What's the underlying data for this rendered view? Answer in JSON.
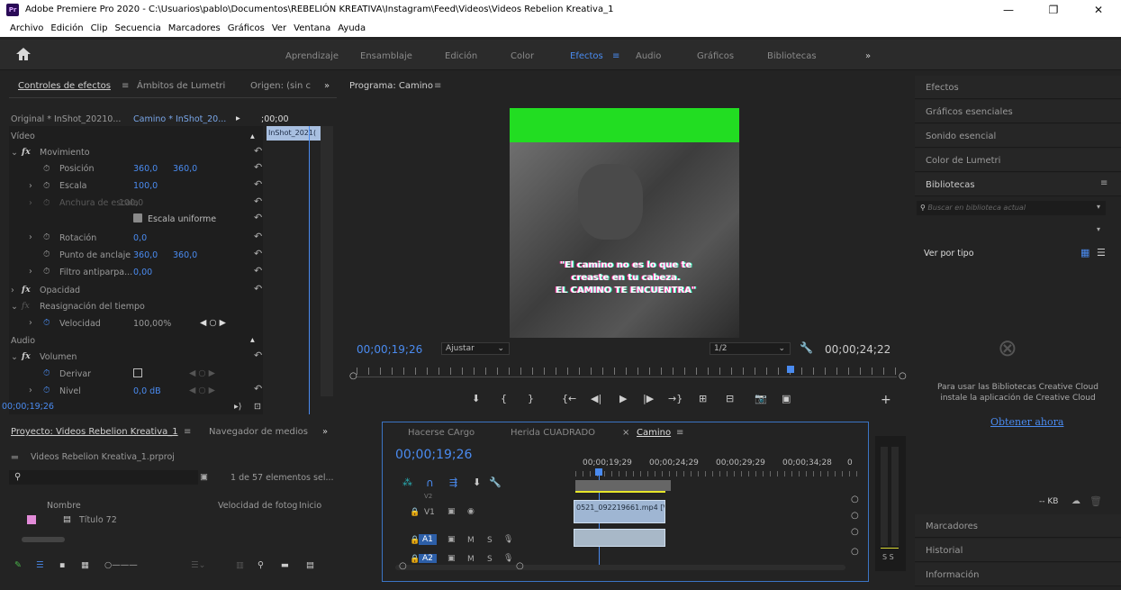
{
  "window": {
    "app_icon": "Pr",
    "title": "Adobe Premiere Pro 2020 - C:\\Usuarios\\pablo\\Documentos\\REBELIÓN KREATIVA\\Instagram\\Feed\\Videos\\Videos Rebelion Kreativa_1",
    "minimize": "—",
    "maximize": "❐",
    "close": "✕"
  },
  "menu": [
    "Archivo",
    "Edición",
    "Clip",
    "Secuencia",
    "Marcadores",
    "Gráficos",
    "Ver",
    "Ventana",
    "Ayuda"
  ],
  "workspaces": [
    "Aprendizaje",
    "Ensamblaje",
    "Edición",
    "Color",
    "Efectos",
    "Audio",
    "Gráficos",
    "Bibliotecas"
  ],
  "workspace_active": "Efectos",
  "workspace_menu_icon": "≡",
  "workspace_more": "»",
  "effect_controls": {
    "tabs": [
      "Controles de efectos",
      "Ámbitos de Lumetri",
      "Origen: (sin c"
    ],
    "tab_menu": "≡",
    "tab_more": "»",
    "source": "Original * InShot_20210...",
    "sequence": "Camino * InShot_20...",
    "timecode_ruler": ";00;00",
    "clip_name": "InShot_2021(",
    "video_label": "Vídeo",
    "movement": "Movimiento",
    "position_label": "Posición",
    "position_x": "360,0",
    "position_y": "360,0",
    "scale_label": "Escala",
    "scale_value": "100,0",
    "scale_width_label": "Anchura de escala",
    "scale_width_value": "100,0",
    "uniform_scale": "Escala uniforme",
    "rotation_label": "Rotación",
    "rotation_value": "0,0",
    "anchor_label": "Punto de anclaje",
    "anchor_x": "360,0",
    "anchor_y": "360,0",
    "flicker_label": "Filtro antiparpa...",
    "flicker_value": "0,00",
    "opacity": "Opacidad",
    "time_remap": "Reasignación del tiempo",
    "speed_label": "Velocidad",
    "speed_value": "100,00%",
    "audio_label": "Audio",
    "volume": "Volumen",
    "bypass_label": "Derivar",
    "level_label": "Nivel",
    "level_value": "0,0 dB",
    "timecode": "00;00;19;26",
    "fx": "fx",
    "reset_icon": "↶"
  },
  "program": {
    "title": "Programa: Camino",
    "menu": "≡",
    "timecode": "00;00;19;26",
    "fit": "Ajustar",
    "resolution": "1/2",
    "duration": "00;00;24;22",
    "caption_line1": "\"El camino no es lo que te",
    "caption_line2": "creaste en tu cabeza.",
    "caption_line3": "EL CAMINO TE ENCUENTRA\""
  },
  "project": {
    "tabs": [
      "Proyecto: Videos Rebelion Kreativa_1",
      "Navegador de medios"
    ],
    "tab_menu": "≡",
    "tab_more": "»",
    "file": "Videos Rebelion Kreativa_1.prproj",
    "search_placeholder": "",
    "count": "1 de 57 elementos sel...",
    "columns": [
      "Nombre",
      "Velocidad de fotog",
      "Inicio"
    ],
    "items": [
      "Título 72"
    ]
  },
  "timeline": {
    "tabs": [
      "Hacerse CArgo",
      "Herida CUADRADO",
      "Camino"
    ],
    "active_tab": "Camino",
    "close": "×",
    "menu": "≡",
    "timecode": "00;00;19;26",
    "ruler": [
      "00;00;19;29",
      "00;00;24;29",
      "00;00;29;29",
      "00;00;34;28",
      "0"
    ],
    "tracks": {
      "v1_target": "V1",
      "v1": "V1",
      "a1": "A1",
      "a2": "A2",
      "v2": "V2",
      "m": "M",
      "s": "S"
    },
    "clip_v1": "0521_092219661.mp4 [V",
    "audio_meter_label": "S S"
  },
  "right_panel": {
    "items": [
      "Efectos",
      "Gráficos esenciales",
      "Sonido esencial",
      "Color de Lumetri",
      "Bibliotecas"
    ],
    "libraries_menu": "≡",
    "search_placeholder": "Buscar en biblioteca actual",
    "view_by": "Ver por tipo",
    "cc_message_line1": "Para usar las Bibliotecas Creative Cloud",
    "cc_message_line2": "instale la aplicación de Creative Cloud",
    "cc_link": "Obtener ahora",
    "kb": "-- KB",
    "bottom_items": [
      "Marcadores",
      "Historial",
      "Información"
    ]
  },
  "colors": {
    "accent": "#4a8bf0",
    "program_green": "#22dd22",
    "swatch_pink": "#e28bd8"
  }
}
